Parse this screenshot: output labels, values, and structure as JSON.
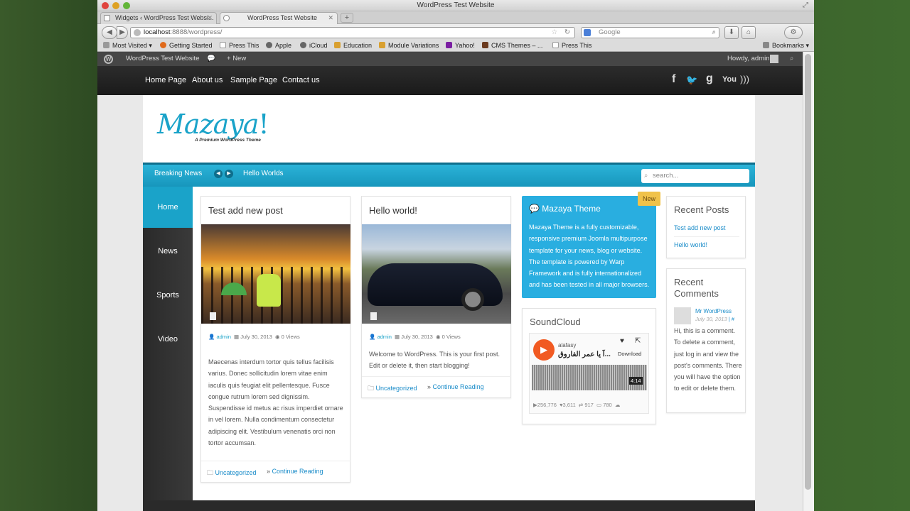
{
  "browser": {
    "window_title": "WordPress Test Website",
    "tabs": [
      {
        "label": "Widgets ‹ WordPress Test Websi..."
      },
      {
        "label": "WordPress Test Website"
      }
    ],
    "new_tab": "+",
    "url_host": "localhost",
    "url_rest": ":8888/wordpress/",
    "search_placeholder": "Google",
    "bookmarks": [
      "Most Visited",
      "Getting Started",
      "Press This",
      "Apple",
      "iCloud",
      "Education",
      "Module Variations",
      "Yahoo!",
      "CMS Themes – ...",
      "Press This"
    ],
    "bookmarks_menu": "Bookmarks"
  },
  "adminbar": {
    "site_name": "WordPress Test Website",
    "new_label": "New",
    "howdy": "Howdy, admin"
  },
  "topnav": {
    "items": [
      "Home Page",
      "About us",
      "Sample Page",
      "Contact us"
    ],
    "social": [
      "f",
      "g",
      "You"
    ]
  },
  "header": {
    "logo": "Mazaya",
    "logo_bang": "!",
    "tagline": "A Premium WordPress Theme"
  },
  "breaking": {
    "label": "Breaking News",
    "headline": "Hello Worlds",
    "search_placeholder": "search..."
  },
  "sidebar_menu": [
    "Home",
    "News",
    "Sports",
    "Video"
  ],
  "posts": [
    {
      "title": "Test add new post",
      "author": "admin",
      "date": "July 30, 2013",
      "views": "0 Views",
      "excerpt": "Maecenas interdum tortor quis tellus facilisis varius. Donec sollicitudin lorem vitae enim iaculis quis feugiat elit pellentesque. Fusce congue rutrum lorem sed dignissim. Suspendisse id metus ac risus imperdiet ornare in vel lorem. Nulla condimentum consectetur adipiscing elit. Vestibulum venenatis orci non tortor accumsan.",
      "category": "Uncategorized",
      "more": "Continue Reading"
    },
    {
      "title": "Hello world!",
      "author": "admin",
      "date": "July 30, 2013",
      "views": "0 Views",
      "excerpt": "Welcome to WordPress. This is your first post. Edit or delete it, then start blogging!",
      "category": "Uncategorized",
      "more": "Continue Reading"
    }
  ],
  "theme_widget": {
    "badge": "New",
    "title": "Mazaya Theme",
    "text": "Mazaya Theme is a fully customizable, responsive premium Joomla multipurpose template for your news, blog or website. The template is powered by Warp Framework and is fully internationalized and has been tested in all major browsers."
  },
  "soundcloud": {
    "title": "SoundCloud",
    "user": "alafasy",
    "track": "آ يا عمر الفاروق...",
    "download": "Download",
    "duration": "4:14",
    "plays": "256,776",
    "likes": "3,611",
    "reposts": "917",
    "comments": "780"
  },
  "recent_posts": {
    "title": "Recent Posts",
    "items": [
      "Test add new post",
      "Hello world!"
    ]
  },
  "recent_comments": {
    "title": "Recent Comments",
    "author": "Mr WordPress",
    "date": "July 30, 2013",
    "sep": "| #",
    "text": "Hi, this is a comment. To delete a comment, just log in and view the post's comments. There you will have the option to edit or delete them."
  },
  "colors": {
    "accent": "#1aa3c9",
    "dark": "#1a1a1a",
    "badge": "#f0c24a"
  }
}
